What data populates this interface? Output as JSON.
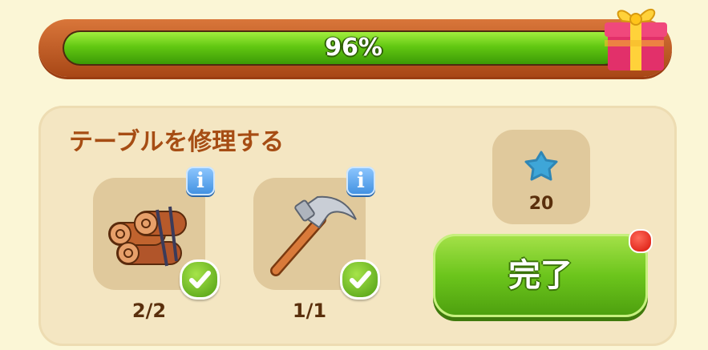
{
  "progress": {
    "percent_label": "96%",
    "value": 0.96,
    "fill_color": "#5cc414"
  },
  "task": {
    "title": "テーブルを修理する",
    "items": [
      {
        "icon": "wood-logs-icon",
        "count": "2/2",
        "complete": true
      },
      {
        "icon": "hammer-icon",
        "count": "1/1",
        "complete": true
      }
    ],
    "reward": {
      "icon": "blue-star-icon",
      "amount": "20"
    }
  },
  "complete_button": {
    "label": "完了"
  },
  "colors": {
    "title": "#a64d14",
    "accent_green": "#6cc51c",
    "panel": "#f4e6c2",
    "info_blue": "#3f8fe0"
  }
}
